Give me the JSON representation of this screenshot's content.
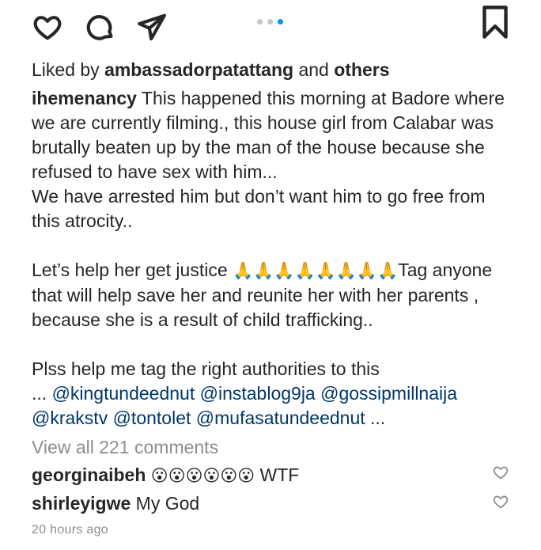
{
  "actions": {
    "like_icon": "heart-outline",
    "comment_icon": "speech-bubble",
    "share_icon": "paper-plane",
    "save_icon": "bookmark-outline",
    "carousel_dots": 3,
    "carousel_active": 3,
    "accent_color": "#0095f6"
  },
  "likes": {
    "prefix": "Liked by ",
    "user": "ambassadorpatattang",
    "mid": " and ",
    "others": "others"
  },
  "caption": {
    "author": "ihemenancy",
    "line1_rest": " This happened this morning at Badore where",
    "line2": "we are currently filming., this house girl from Calabar was",
    "line3": "brutally beaten up by the man of the house because she",
    "line4": "refused to have sex with him...",
    "line5": "We have arrested him but don’t want him to go free from",
    "line6": "this atrocity..",
    "line7_a": "Let’s help her get justice ",
    "line7_emoji": "🙏🙏🙏🙏🙏🙏🙏🙏",
    "line7_b": "Tag anyone",
    "line8": "that will help save her and reunite her with her parents ,",
    "line9": "because she is a result of child trafficking..",
    "line10": "Plss help me tag the right authorities to this",
    "line11_prefix": "... ",
    "line11_mentions": "@kingtundeednut @instablog9ja @gossipmillnaija",
    "line12_mentions": "@krakstv @tontolet @mufasatundeednut",
    "line12_suffix": " ..."
  },
  "view_all_comments": "View all 221 comments",
  "comments": [
    {
      "user": "georginaibeh",
      "emoji": "😮😮😮😮😮😮",
      "text": " WTF"
    },
    {
      "user": "shirleyigwe",
      "emoji": "",
      "text": " My God"
    }
  ],
  "timestamp": "20 hours ago"
}
